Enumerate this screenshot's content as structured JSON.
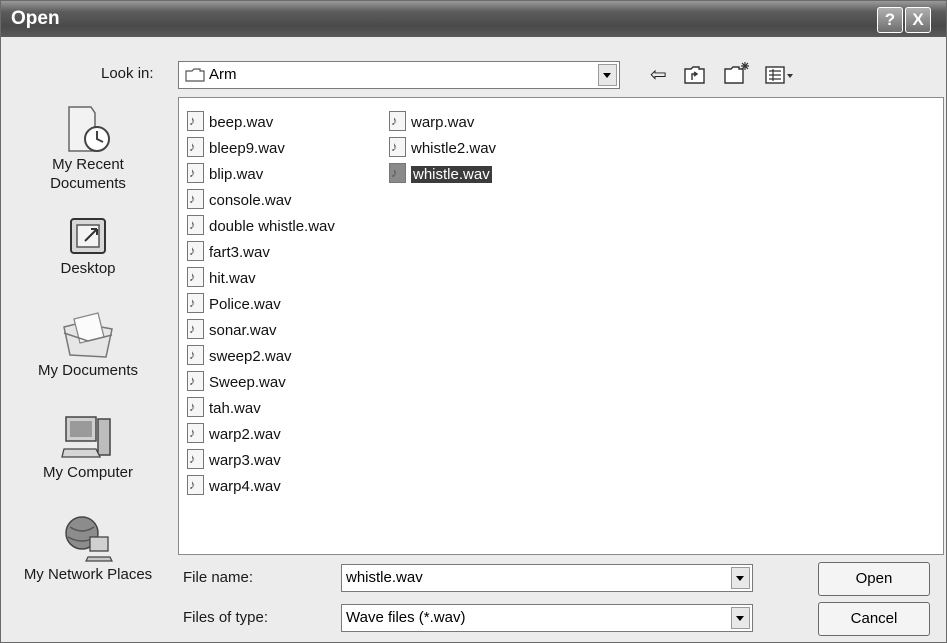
{
  "window": {
    "title": "Open",
    "help_glyph": "?",
    "close_glyph": "X"
  },
  "look_in": {
    "label": "Look in:",
    "value": "Arm"
  },
  "places": [
    {
      "label": "My Recent Documents",
      "icon": "recent-documents-icon"
    },
    {
      "label": "Desktop",
      "icon": "desktop-icon"
    },
    {
      "label": "My Documents",
      "icon": "my-documents-icon"
    },
    {
      "label": "My Computer",
      "icon": "my-computer-icon"
    },
    {
      "label": "My Network Places",
      "icon": "network-places-icon"
    }
  ],
  "files_col1": [
    "beep.wav",
    "bleep9.wav",
    "blip.wav",
    "console.wav",
    "double whistle.wav",
    "fart3.wav",
    "hit.wav",
    "Police.wav",
    "sonar.wav",
    "sweep2.wav",
    "Sweep.wav",
    "tah.wav",
    "warp2.wav",
    "warp3.wav",
    "warp4.wav"
  ],
  "files_col2": [
    "warp.wav",
    "whistle2.wav",
    "whistle.wav"
  ],
  "selected_file": "whistle.wav",
  "file_name": {
    "label": "File name:",
    "value": "whistle.wav"
  },
  "file_type": {
    "label": "Files of type:",
    "value": "Wave files (*.wav)"
  },
  "buttons": {
    "open": "Open",
    "cancel": "Cancel"
  }
}
